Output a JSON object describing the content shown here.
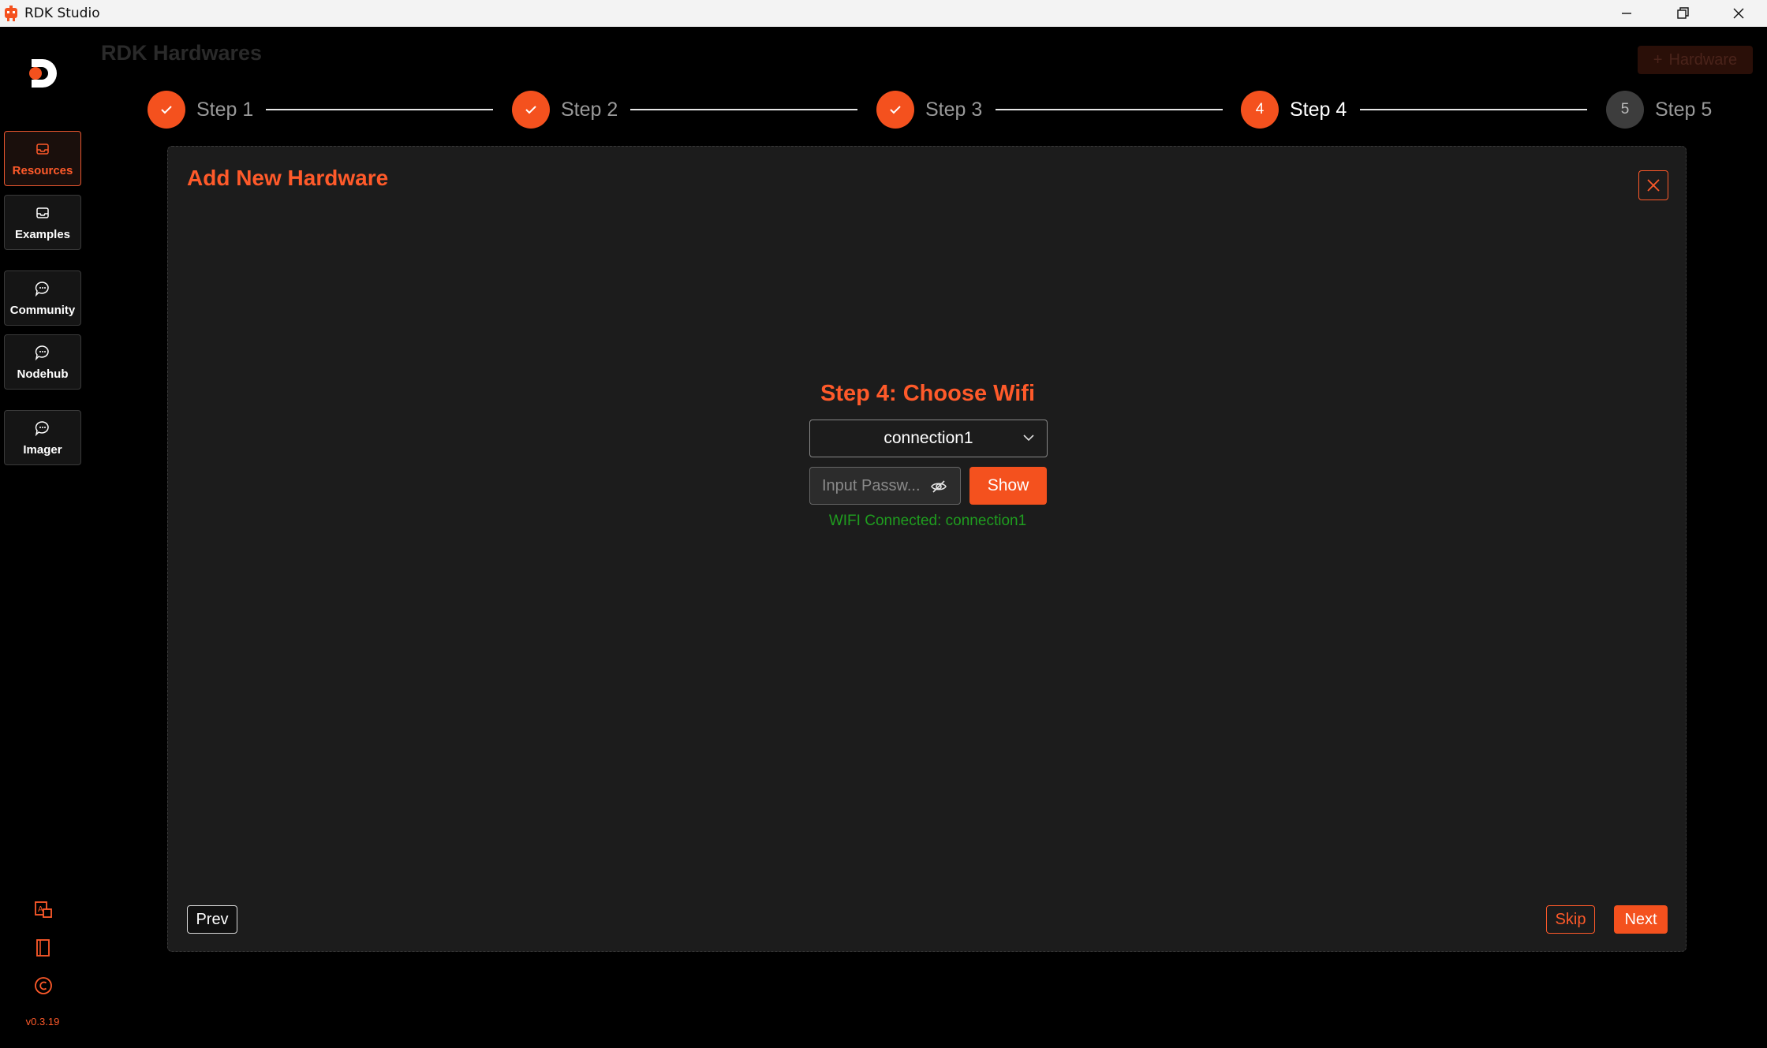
{
  "window": {
    "title": "RDK Studio"
  },
  "sidebar": {
    "items": [
      {
        "label": "Resources",
        "icon": "inbox-icon",
        "active": true
      },
      {
        "label": "Examples",
        "icon": "inbox-icon",
        "active": false
      },
      {
        "label": "Community",
        "icon": "chat-icon",
        "active": false
      },
      {
        "label": "Nodehub",
        "icon": "chat-icon",
        "active": false
      },
      {
        "label": "Imager",
        "icon": "chat-icon",
        "active": false
      }
    ],
    "version": "v0.3.19"
  },
  "header": {
    "title": "RDK Hardwares",
    "add_label": "Hardware"
  },
  "steps": [
    {
      "label": "Step 1",
      "state": "done"
    },
    {
      "label": "Step 2",
      "state": "done"
    },
    {
      "label": "Step 3",
      "state": "done"
    },
    {
      "label": "Step 4",
      "number": "4",
      "state": "current"
    },
    {
      "label": "Step 5",
      "number": "5",
      "state": "pending"
    }
  ],
  "modal": {
    "title": "Add New Hardware",
    "step_heading": "Step 4: Choose Wifi",
    "wifi_selected": "connection1",
    "password_placeholder": "Input Passw...",
    "show_label": "Show",
    "status": "WIFI Connected: connection1",
    "prev_label": "Prev",
    "skip_label": "Skip",
    "next_label": "Next"
  },
  "colors": {
    "accent": "#f4511e",
    "success": "#1f9d1f",
    "background": "#000000",
    "panel": "#1c1c1c"
  }
}
